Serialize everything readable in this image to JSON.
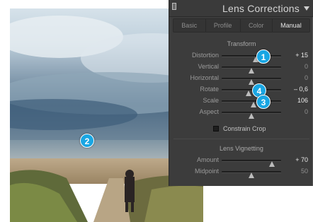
{
  "panel": {
    "title": "Lens Corrections",
    "tabs": [
      {
        "label": "Basic",
        "active": false
      },
      {
        "label": "Profile",
        "active": false
      },
      {
        "label": "Color",
        "active": false
      },
      {
        "label": "Manual",
        "active": true
      }
    ],
    "transform": {
      "title": "Transform",
      "rows": [
        {
          "label": "Distortion",
          "value": "+ 15",
          "position": 0.57,
          "highlight": true
        },
        {
          "label": "Vertical",
          "value": "0",
          "position": 0.5,
          "highlight": false
        },
        {
          "label": "Horizontal",
          "value": "0",
          "position": 0.5,
          "highlight": false
        },
        {
          "label": "Rotate",
          "value": "– 0,6",
          "position": 0.45,
          "highlight": true
        },
        {
          "label": "Scale",
          "value": "106",
          "position": 0.53,
          "highlight": true
        },
        {
          "label": "Aspect",
          "value": "0",
          "position": 0.5,
          "highlight": false
        }
      ],
      "constrain_crop": {
        "label": "Constrain Crop",
        "checked": false
      }
    },
    "vignetting": {
      "title": "Lens Vignetting",
      "rows": [
        {
          "label": "Amount",
          "value": "+ 70",
          "position": 0.85,
          "highlight": true
        },
        {
          "label": "Midpoint",
          "value": "50",
          "position": 0.5,
          "highlight": false
        }
      ]
    }
  },
  "callouts": {
    "c1": "1",
    "c2": "2",
    "c3": "3",
    "c4": "4"
  },
  "colors": {
    "callout": "#19a6e3",
    "panel_bg": "#3c3c3c"
  }
}
